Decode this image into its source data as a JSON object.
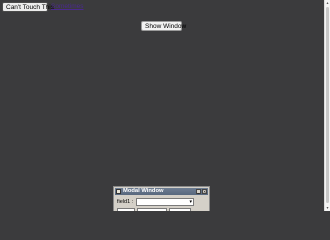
{
  "toolbar": {
    "cant_touch_label": "Can't Touch This",
    "purple_link_text": "Sometimes"
  },
  "main": {
    "show_window_label": "Show Window"
  },
  "modal": {
    "title": "Modal Window",
    "minimize_glyph": "_",
    "close_glyph": "×",
    "field1_label": "field1 :",
    "select_value": "",
    "select_arrow": "▾"
  },
  "scrollbar": {
    "up_glyph": "▴",
    "down_glyph": "▾"
  },
  "colors": {
    "background": "#3b3b3d",
    "link": "#4b2a8e",
    "modal_titlebar": "#57677d",
    "modal_body": "#d4d0c8"
  }
}
